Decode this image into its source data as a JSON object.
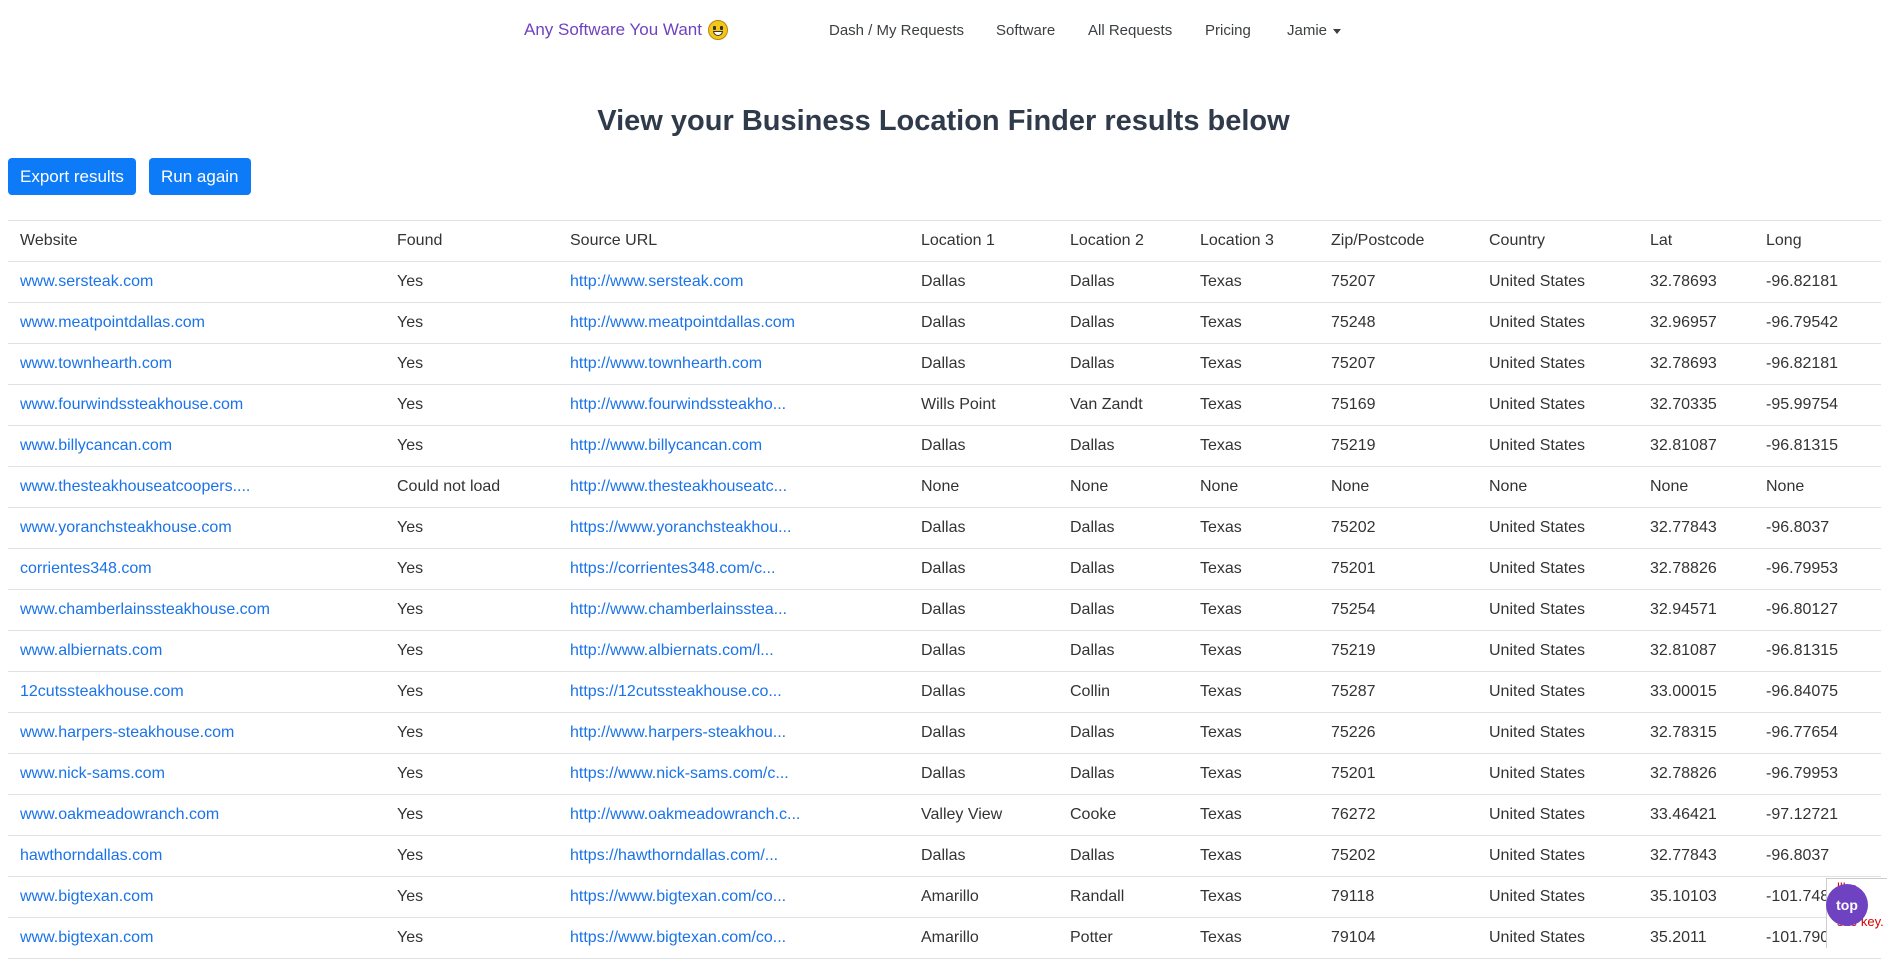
{
  "nav": {
    "brand": "Any Software You Want",
    "items": [
      "Dash / My Requests",
      "Software",
      "All Requests",
      "Pricing"
    ],
    "user": "Jamie"
  },
  "page": {
    "title": "View your Business Location Finder results below"
  },
  "actions": {
    "export_label": "Export results",
    "run_again_label": "Run again"
  },
  "table": {
    "headers": [
      "Website",
      "Found",
      "Source URL",
      "Location 1",
      "Location 2",
      "Location 3",
      "Zip/Postcode",
      "Country",
      "Lat",
      "Long"
    ],
    "rows": [
      [
        "www.sersteak.com",
        "Yes",
        "http://www.sersteak.com",
        "Dallas",
        "Dallas",
        "Texas",
        "75207",
        "United States",
        "32.78693",
        "-96.82181"
      ],
      [
        "www.meatpointdallas.com",
        "Yes",
        "http://www.meatpointdallas.com",
        "Dallas",
        "Dallas",
        "Texas",
        "75248",
        "United States",
        "32.96957",
        "-96.79542"
      ],
      [
        "www.townhearth.com",
        "Yes",
        "http://www.townhearth.com",
        "Dallas",
        "Dallas",
        "Texas",
        "75207",
        "United States",
        "32.78693",
        "-96.82181"
      ],
      [
        "www.fourwindssteakhouse.com",
        "Yes",
        "http://www.fourwindssteakho...",
        "Wills Point",
        "Van Zandt",
        "Texas",
        "75169",
        "United States",
        "32.70335",
        "-95.99754"
      ],
      [
        "www.billycancan.com",
        "Yes",
        "http://www.billycancan.com",
        "Dallas",
        "Dallas",
        "Texas",
        "75219",
        "United States",
        "32.81087",
        "-96.81315"
      ],
      [
        "www.thesteakhouseatcoopers....",
        "Could not load",
        "http://www.thesteakhouseatc...",
        "None",
        "None",
        "None",
        "None",
        "None",
        "None",
        "None"
      ],
      [
        "www.yoranchsteakhouse.com",
        "Yes",
        "https://www.yoranchsteakhou...",
        "Dallas",
        "Dallas",
        "Texas",
        "75202",
        "United States",
        "32.77843",
        "-96.8037"
      ],
      [
        "corrientes348.com",
        "Yes",
        "https://corrientes348.com/c...",
        "Dallas",
        "Dallas",
        "Texas",
        "75201",
        "United States",
        "32.78826",
        "-96.79953"
      ],
      [
        "www.chamberlainssteakhouse.com",
        "Yes",
        "http://www.chamberlainsstea...",
        "Dallas",
        "Dallas",
        "Texas",
        "75254",
        "United States",
        "32.94571",
        "-96.80127"
      ],
      [
        "www.albiernats.com",
        "Yes",
        "http://www.albiernats.com/l...",
        "Dallas",
        "Dallas",
        "Texas",
        "75219",
        "United States",
        "32.81087",
        "-96.81315"
      ],
      [
        "12cutssteakhouse.com",
        "Yes",
        "https://12cutssteakhouse.co...",
        "Dallas",
        "Collin",
        "Texas",
        "75287",
        "United States",
        "33.00015",
        "-96.84075"
      ],
      [
        "www.harpers-steakhouse.com",
        "Yes",
        "http://www.harpers-steakhou...",
        "Dallas",
        "Dallas",
        "Texas",
        "75226",
        "United States",
        "32.78315",
        "-96.77654"
      ],
      [
        "www.nick-sams.com",
        "Yes",
        "https://www.nick-sams.com/c...",
        "Dallas",
        "Dallas",
        "Texas",
        "75201",
        "United States",
        "32.78826",
        "-96.79953"
      ],
      [
        "www.oakmeadowranch.com",
        "Yes",
        "http://www.oakmeadowranch.c...",
        "Valley View",
        "Cooke",
        "Texas",
        "76272",
        "United States",
        "33.46421",
        "-97.12721"
      ],
      [
        "hawthorndallas.com",
        "Yes",
        "https://hawthorndallas.com/...",
        "Dallas",
        "Dallas",
        "Texas",
        "75202",
        "United States",
        "32.77843",
        "-96.8037"
      ],
      [
        "www.bigtexan.com",
        "Yes",
        "https://www.bigtexan.com/co...",
        "Amarillo",
        "Randall",
        "Texas",
        "79118",
        "United States",
        "35.10103",
        "-101.748"
      ],
      [
        "www.bigtexan.com",
        "Yes",
        "https://www.bigtexan.com/co...",
        "Amarillo",
        "Potter",
        "Texas",
        "79104",
        "United States",
        "35.2011",
        "-101.790"
      ]
    ]
  },
  "widgets": {
    "top_label": "top",
    "recaptcha_lines": [
      "llho",
      "porte",
      "site key."
    ]
  }
}
